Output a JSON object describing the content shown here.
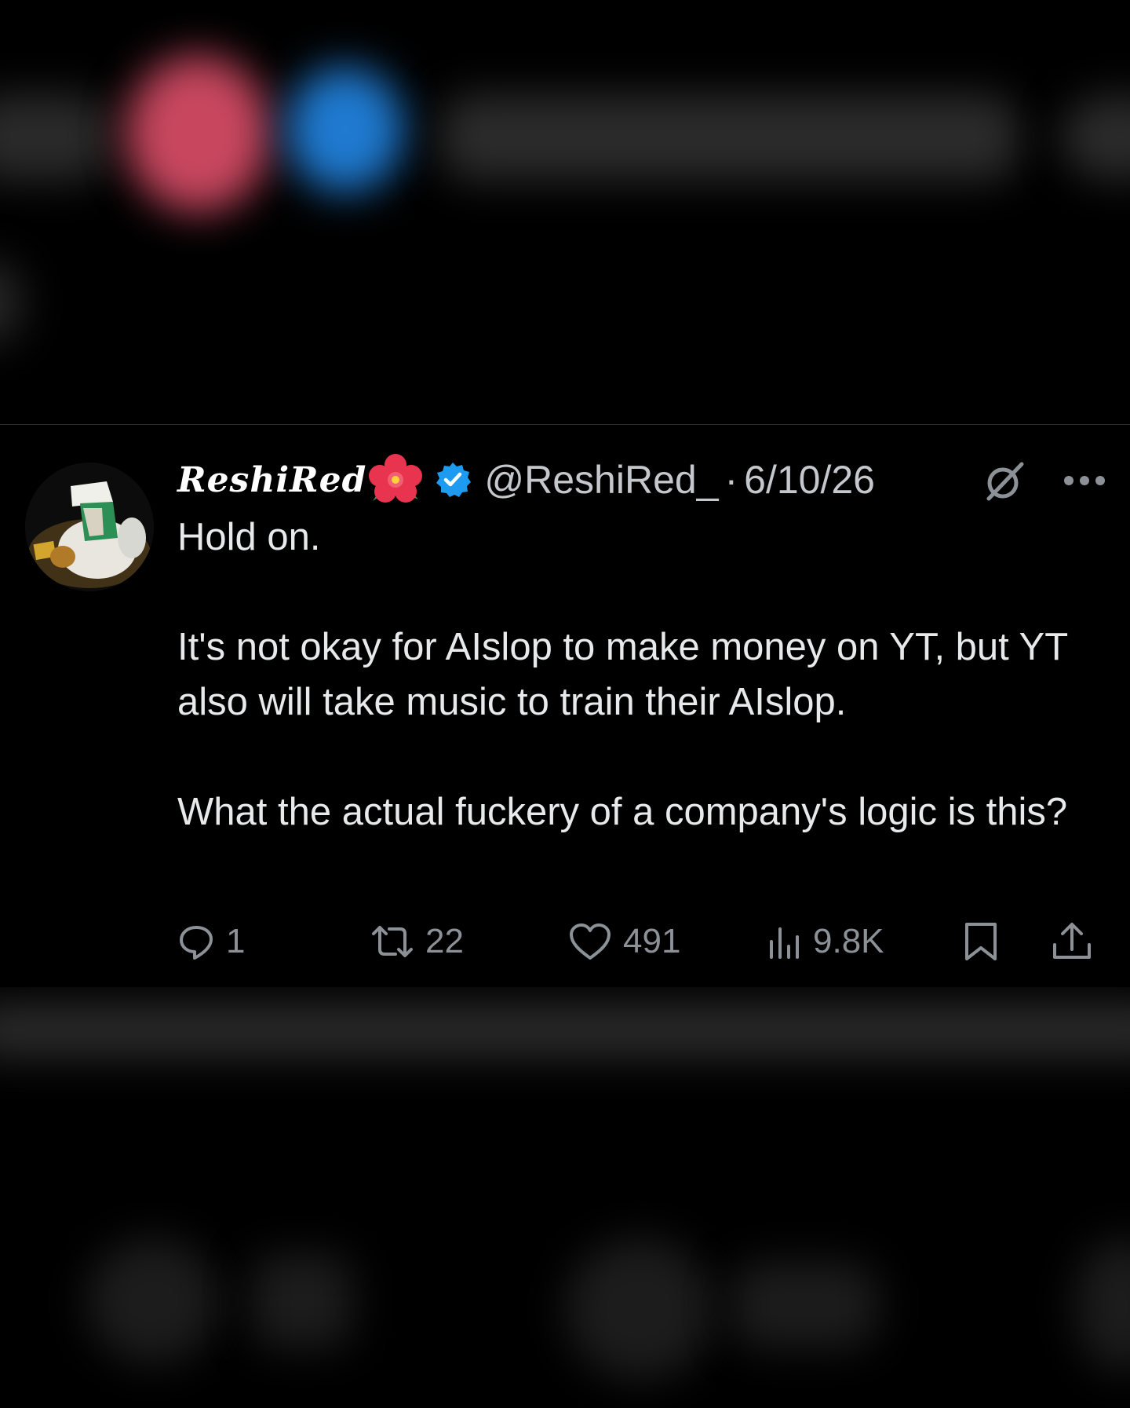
{
  "tweet": {
    "display_name": "ReshiRed",
    "name_emoji": "flower-icon",
    "verified": true,
    "handle": "@ReshiRed_",
    "separator": "·",
    "date": "6/10/26",
    "paragraphs": [
      "Hold on.",
      "It's not okay for AIslop to make money on YT, but YT also will take music to train their AIslop.",
      "What the actual fuckery of a company's logic is this?"
    ],
    "actions": {
      "replies": "1",
      "reposts": "22",
      "likes": "491",
      "views": "9.8K"
    }
  },
  "colors": {
    "background": "#000000",
    "text": "#e7e9ea",
    "secondary": "#8b9196",
    "verified_blue": "#1d9bf0",
    "divider": "#2f3336"
  }
}
